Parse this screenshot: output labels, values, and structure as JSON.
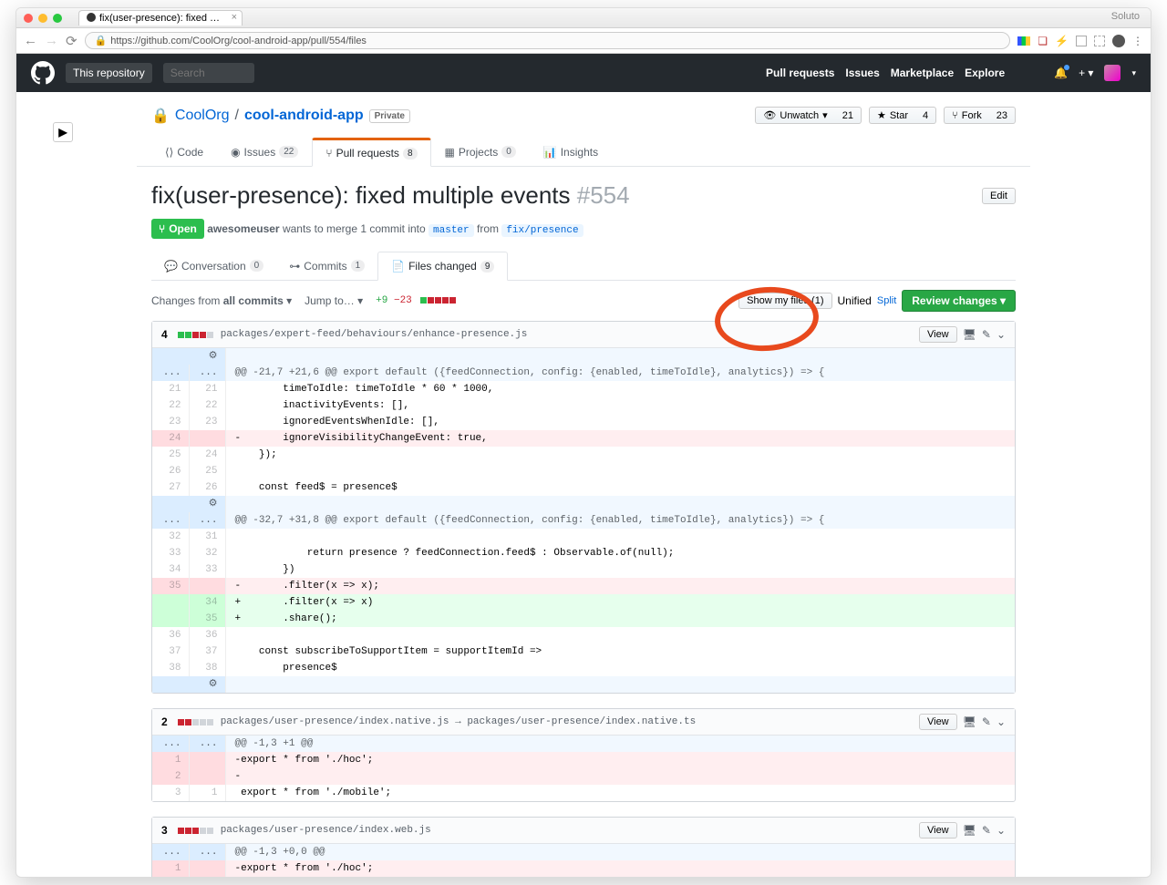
{
  "browser": {
    "tab_title": "fix(user-presence): fixed mult…",
    "url": "https://github.com/CoolOrg/cool-android-app/pull/554/files",
    "profile": "Soluto"
  },
  "header": {
    "this_repo": "This repository",
    "search_placeholder": "Search",
    "nav": {
      "pulls": "Pull requests",
      "issues": "Issues",
      "marketplace": "Marketplace",
      "explore": "Explore"
    }
  },
  "repo": {
    "owner": "CoolOrg",
    "name": "cool-android-app",
    "privacy": "Private",
    "actions": {
      "unwatch": "Unwatch",
      "unwatch_count": "21",
      "star": "Star",
      "star_count": "4",
      "fork": "Fork",
      "fork_count": "23"
    },
    "tabs": {
      "code": "Code",
      "issues": "Issues",
      "issues_count": "22",
      "pulls": "Pull requests",
      "pulls_count": "8",
      "projects": "Projects",
      "projects_count": "0",
      "insights": "Insights"
    }
  },
  "pr": {
    "title": "fix(user-presence): fixed multiple events",
    "number": "#554",
    "edit": "Edit",
    "state": "Open",
    "author": "awesomeuser",
    "merge_text": "wants to merge 1 commit into",
    "base": "master",
    "from": "from",
    "head": "fix/presence",
    "tabs": {
      "conv": "Conversation",
      "conv_count": "0",
      "commits": "Commits",
      "commits_count": "1",
      "files": "Files changed",
      "files_count": "9"
    }
  },
  "toolbar": {
    "changes_from": "Changes from",
    "all_commits": "all commits",
    "jump_to": "Jump to…",
    "add": "+9",
    "del": "−23",
    "show_my_files": "Show my files (1)",
    "unified": "Unified",
    "split": "Split",
    "review": "Review changes"
  },
  "files": [
    {
      "count": "4",
      "path": "packages/expert-feed/behaviours/enhance-presence.js",
      "view": "View"
    },
    {
      "count": "2",
      "path": "packages/user-presence/index.native.js → packages/user-presence/index.native.ts",
      "view": "View"
    },
    {
      "count": "3",
      "path": "packages/user-presence/index.web.js",
      "view": "View"
    }
  ],
  "diff1": {
    "h1": "@@ -21,7 +21,6 @@ export default ({feedConnection, config: {enabled, timeToIdle}, analytics}) => {",
    "l21a": "21",
    "l21b": "21",
    "c21": "        timeToIdle: timeToIdle * 60 * 1000,",
    "l22a": "22",
    "l22b": "22",
    "c22": "        inactivityEvents: [],",
    "l23a": "23",
    "l23b": "23",
    "c23": "        ignoredEventsWhenIdle: [],",
    "l24a": "24",
    "c24": "-       ignoreVisibilityChangeEvent: true,",
    "l25a": "25",
    "l25b": "24",
    "c25": "    });",
    "l26a": "26",
    "l26b": "25",
    "c26": "",
    "l27a": "27",
    "l27b": "26",
    "c27": "    const feed$ = presence$",
    "h2": "@@ -32,7 +31,8 @@ export default ({feedConnection, config: {enabled, timeToIdle}, analytics}) => {",
    "l32a": "32",
    "l32b": "31",
    "c32": "",
    "l33a": "33",
    "l33b": "32",
    "c33": "            return presence ? feedConnection.feed$ : Observable.of(null);",
    "l34a": "34",
    "l34b": "33",
    "c34": "        })",
    "l35a": "35",
    "c35": "-       .filter(x => x);",
    "l35b": "34",
    "c35b": "+       .filter(x => x)",
    "l35c": "35",
    "c35c": "+       .share();",
    "l36a": "36",
    "l36b": "36",
    "c36": "",
    "l37a": "37",
    "l37b": "37",
    "c37": "    const subscribeToSupportItem = supportItemId =>",
    "l38a": "38",
    "l38b": "38",
    "c38": "        presence$"
  },
  "diff2": {
    "h1": "@@ -1,3 +1 @@",
    "l1a": "1",
    "c1": "-export * from './hoc';",
    "l2a": "2",
    "c2": "-",
    "l3a": "3",
    "l3b": "1",
    "c3": " export * from './mobile';"
  },
  "diff3": {
    "h1": "@@ -1,3 +0,0 @@",
    "l1a": "1",
    "c1": "-export * from './hoc';"
  },
  "dots": "..."
}
